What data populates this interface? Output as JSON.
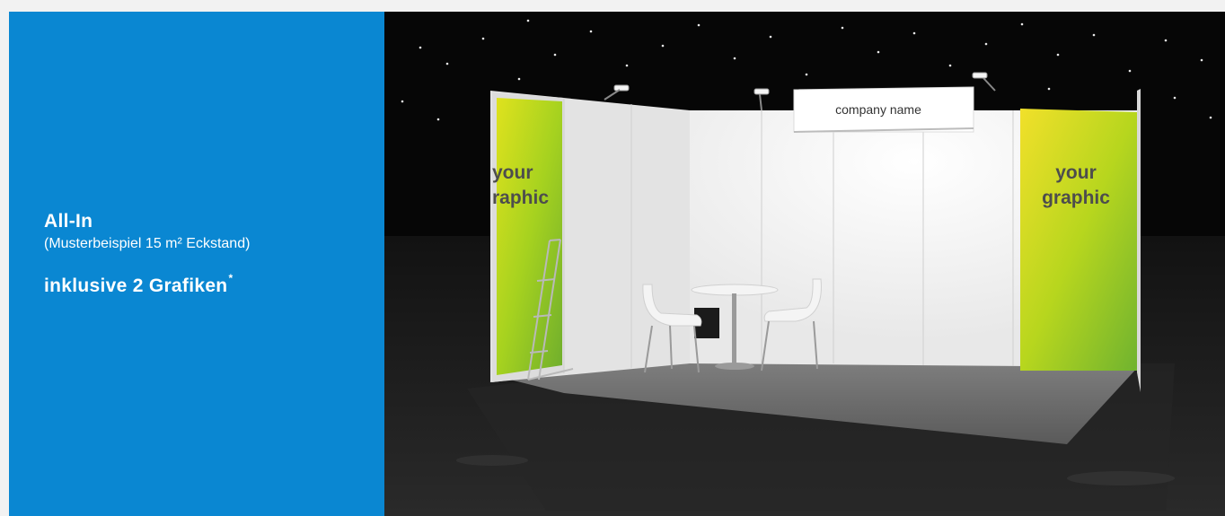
{
  "panel": {
    "title": "All-In",
    "subtitle": "(Musterbeispiel 15 m² Eckstand)",
    "inclusive_text": "inklusive 2 Grafiken",
    "footnote_mark": "*",
    "background_color": "#0a87d2"
  },
  "booth": {
    "header_sign": "company name",
    "left_graphic_line1": "your",
    "left_graphic_line2": "raphic",
    "right_graphic_line1": "your",
    "right_graphic_line2": "graphic"
  },
  "colors": {
    "graphic_green": "#9ccc1c",
    "graphic_text": "#4d4d4d",
    "floor_dark": "#1c1c1c"
  }
}
